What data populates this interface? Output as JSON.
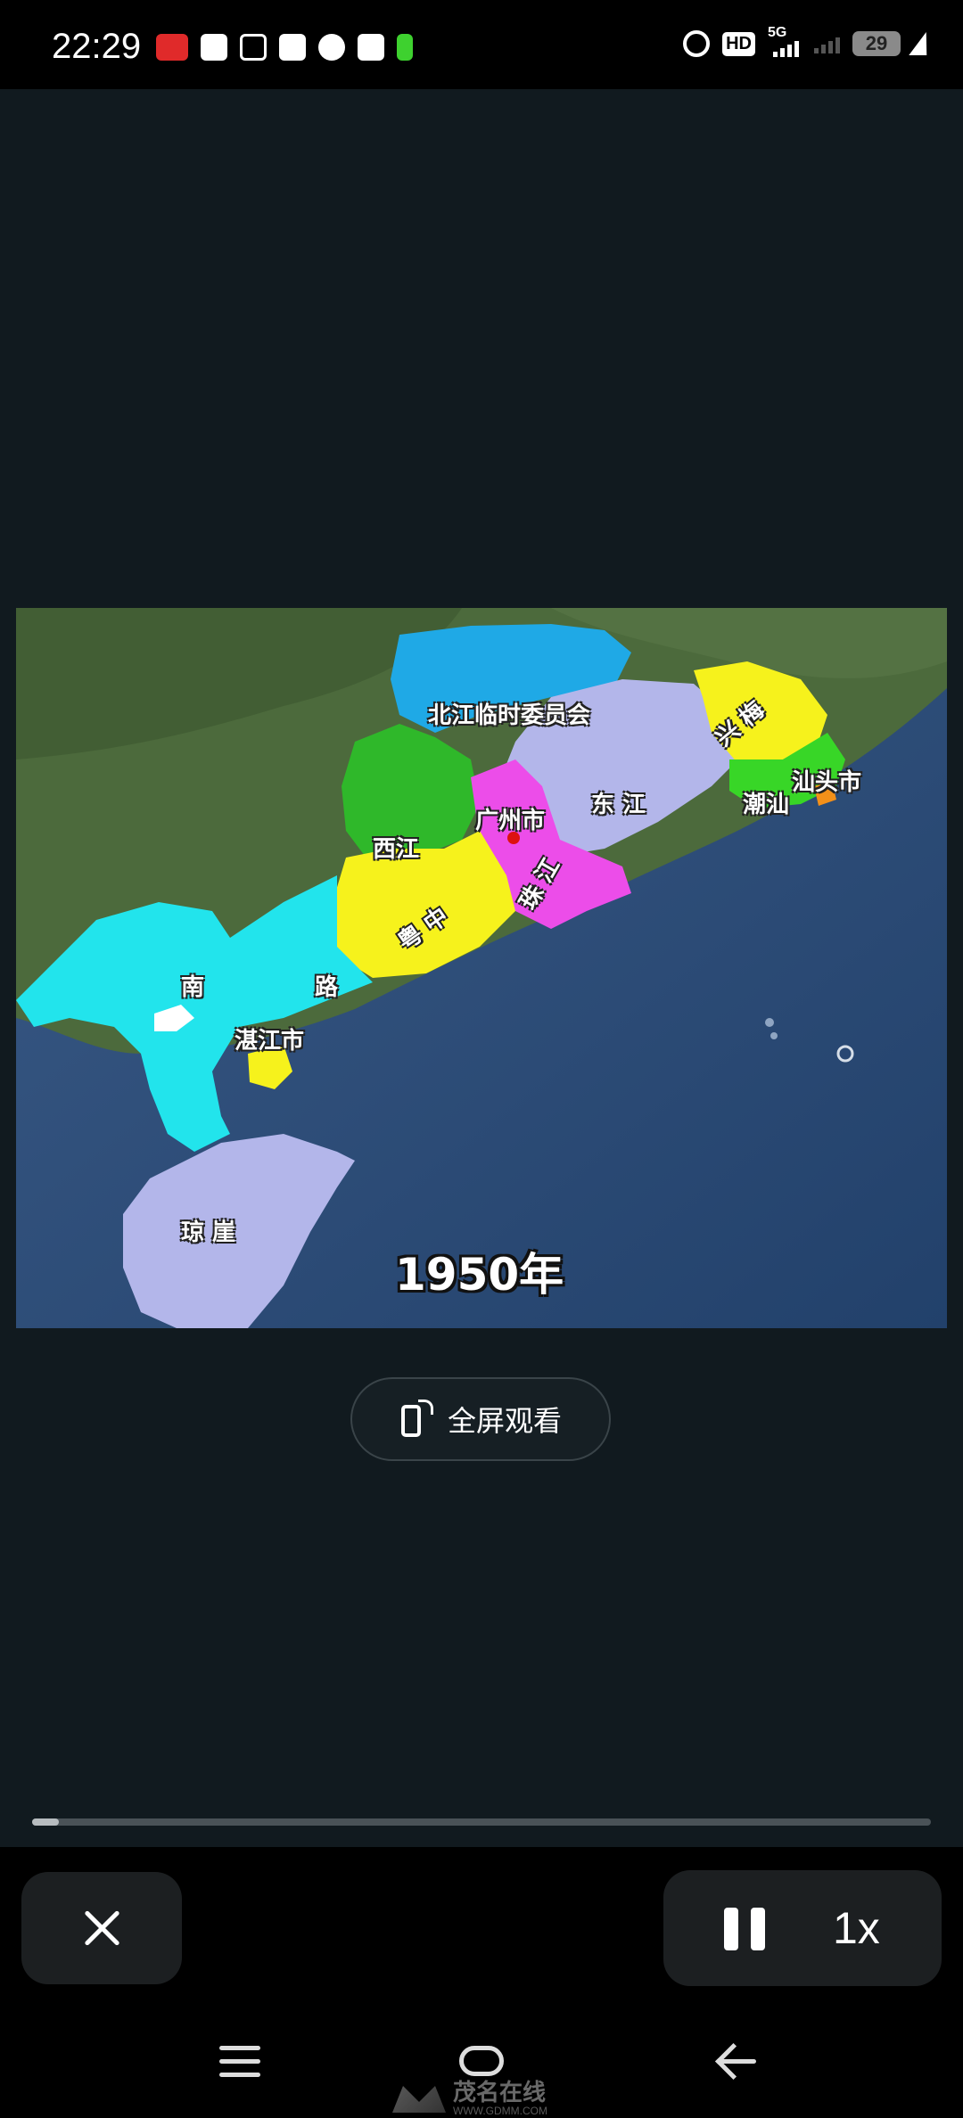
{
  "status_bar": {
    "time": "22:29",
    "hd_label": "HD",
    "network_label": "5G",
    "battery": "29"
  },
  "video": {
    "year": "1950年",
    "labels": {
      "beijiang": "北江临时委员会",
      "xijiang": "西江",
      "guangzhou": "广州市",
      "dongjiang": "东 江",
      "xingmei": "兴 梅",
      "chaoshan": "潮汕",
      "shantou": "汕头市",
      "zhujiang": "珠 江",
      "yuezhong": "粤 中",
      "nanlu_1": "南",
      "nanlu_2": "路",
      "zhanjiang": "湛江市",
      "qiongya": "琼 崖"
    },
    "region_colors": {
      "beijiang": "#1fa9e6",
      "xijiang": "#2fb82a",
      "dongjiang": "#b3b6ea",
      "xingmei": "#f6f21c",
      "chaoshan": "#38d627",
      "zhujiang": "#ec4de9",
      "yuezhong": "#f6f21c",
      "nanlu": "#22e4ec",
      "qiongya": "#b3b6ea"
    }
  },
  "fullscreen": {
    "label": "全屏观看"
  },
  "progress": {
    "fraction": 0.03
  },
  "controls": {
    "speed": "1x"
  },
  "watermark": {
    "text": "茂名在线",
    "sub": "WWW.GDMM.COM"
  }
}
